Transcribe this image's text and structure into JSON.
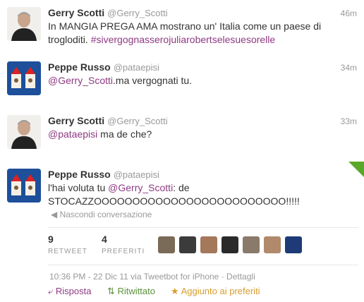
{
  "tweets": [
    {
      "name": "Gerry Scotti",
      "handle": "@Gerry_Scotti",
      "time": "46m",
      "text_line1": "In MANGIA PREGA AMA mostrano un' Italia come un paese di",
      "text_line2_plain": "trogloditi. ",
      "hashtag": "#sivergognasserojuliarobertselesuesorelle"
    },
    {
      "name": "Peppe Russo",
      "handle": "@pataepisi",
      "time": "34m",
      "mention": "@Gerry_Scotti",
      "text_rest": ".ma vergognati tu."
    },
    {
      "name": "Gerry Scotti",
      "handle": "@Gerry_Scotti",
      "time": "33m",
      "mention": "@pataepisi",
      "text_rest": " ma de che?"
    },
    {
      "name": "Peppe Russo",
      "handle": "@pataepisi",
      "text_pre": "l'hai voluta tu ",
      "mention": "@Gerry_Scotti",
      "text_post": ": de",
      "text_line2": "STOCAZZOOOOOOOOOOOOOOOOOOOOOOOOO!!!!!",
      "hide_conversation": "Nascondi conversazione",
      "retweets": "9",
      "retweets_label": "RETWEET",
      "favorites": "4",
      "favorites_label": "PREFERITI",
      "timestamp": "10:36 PM - 22 Dic 11 via Tweetbot for iPhone",
      "details": "Dettagli",
      "reply_label": "Risposta",
      "retweeted_label": "Ritwittato",
      "favorited_label": "Aggiunto ai preferiti"
    }
  ],
  "colors": {
    "link": "#8e3a82",
    "retweet": "#5c913b",
    "favorite": "#d79d2c",
    "muted": "#999999"
  },
  "icons": {
    "hide": "left-arrow-icon",
    "reply": "reply-icon",
    "retweet": "retweet-icon",
    "favorite": "star-icon"
  }
}
